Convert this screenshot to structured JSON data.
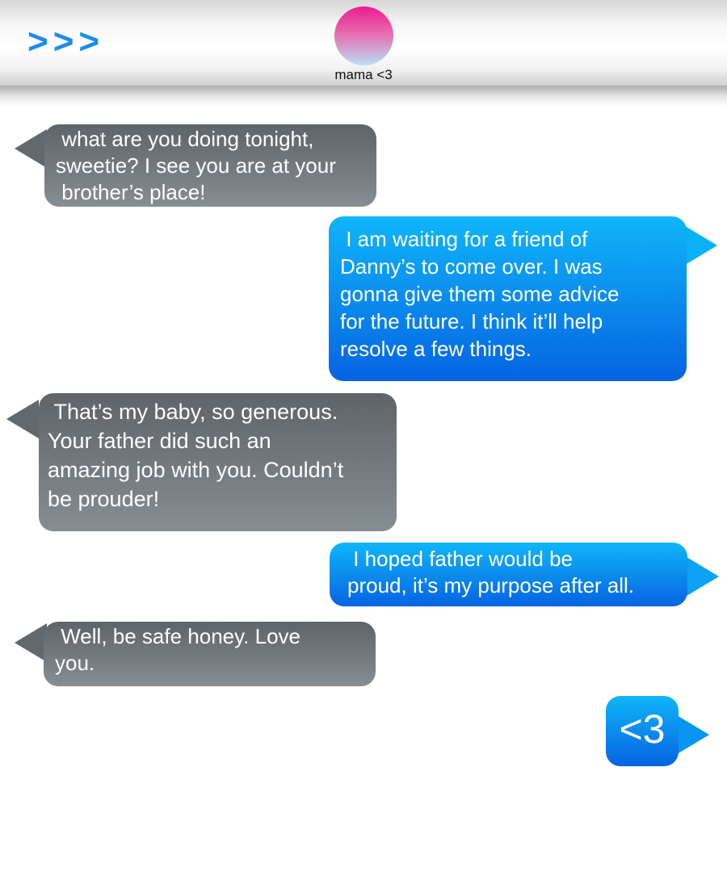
{
  "header": {
    "back_label": ">>>",
    "contact_name": "mama <3"
  },
  "messages": [
    {
      "from": "contact",
      "text": " what are you doing tonight,\nsweetie? I see you are at your\n brother’s place!"
    },
    {
      "from": "me",
      "text": " I am waiting for a friend of\nDanny’s to come over. I was\ngonna give them some advice\nfor the future. I think it’ll help\nresolve a few things."
    },
    {
      "from": "contact",
      "text": " That’s my baby, so generous.\nYour father did such an\namazing job with you. Couldn’t\nbe prouder!"
    },
    {
      "from": "me",
      "text": " I hoped father would be\nproud, it’s my purpose after all."
    },
    {
      "from": "contact",
      "text": " Well, be safe honey. Love\nyou."
    },
    {
      "from": "me",
      "text": "<3"
    }
  ],
  "colors": {
    "back_arrow": "#1a8cf0",
    "received_bubble_top": "#5e6468",
    "received_bubble_bottom": "#868d93",
    "sent_bubble_top": "#0fb6f9",
    "sent_bubble_bottom": "#0663e2",
    "avatar_top": "#ec1c8f",
    "avatar_bottom": "#b9dff5"
  }
}
